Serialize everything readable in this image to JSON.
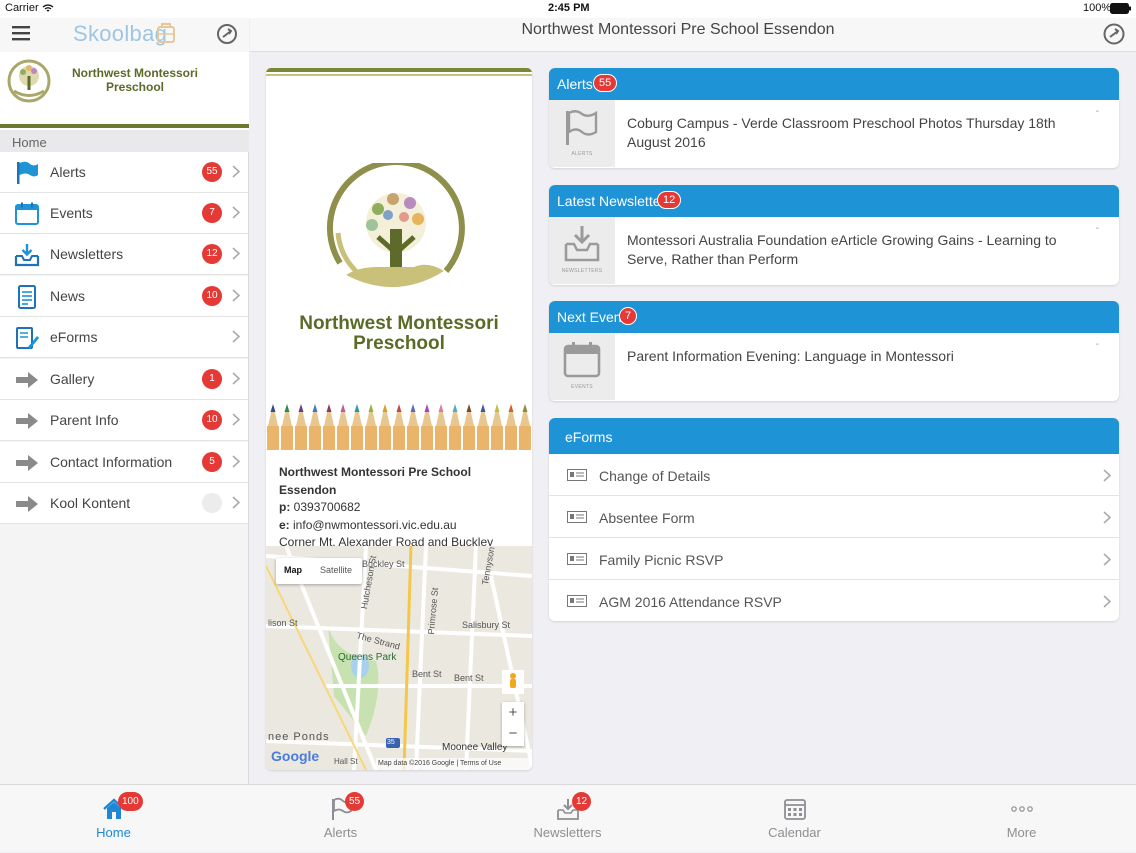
{
  "status": {
    "carrier": "Carrier",
    "time": "2:45 PM",
    "battery": "100%"
  },
  "sidebar": {
    "brand": "Skoolbag",
    "school_name_line1": "Northwest Montessori",
    "school_name_line2": "Preschool",
    "home_label": "Home",
    "items": [
      {
        "label": "Alerts",
        "badge": "55",
        "icon": "flag-icon"
      },
      {
        "label": "Events",
        "badge": "7",
        "icon": "calendar-icon"
      },
      {
        "label": "Newsletters",
        "badge": "12",
        "icon": "inbox-download-icon"
      },
      {
        "label": "News",
        "badge": "10",
        "icon": "document-icon"
      },
      {
        "label": "eForms",
        "badge": "",
        "icon": "form-pen-icon"
      },
      {
        "label": "Gallery",
        "badge": "1",
        "icon": "arrow-right-icon"
      },
      {
        "label": "Parent Info",
        "badge": "10",
        "icon": "arrow-right-icon"
      },
      {
        "label": "Contact Information",
        "badge": "5",
        "icon": "arrow-right-icon"
      },
      {
        "label": "Kool Kontent",
        "badge": "",
        "icon": "arrow-right-icon"
      }
    ]
  },
  "header": {
    "title": "Northwest Montessori Pre School Essendon"
  },
  "school_card": {
    "logo_line1": "Northwest Montessori",
    "logo_line2": "Preschool",
    "name": "Northwest Montessori Pre School Essendon",
    "phone_label": "p:",
    "phone": "0393700682",
    "email_label": "e:",
    "email": "info@nwmontessori.vic.edu.au",
    "address": "Corner Mt. Alexander Road and Buckley",
    "map": {
      "btn_map": "Map",
      "btn_satellite": "Satellite",
      "zoom_in": "+",
      "zoom_out": "−",
      "google": "Google",
      "attribution": "Map data ©2016 Google",
      "terms": "Terms of Use",
      "streets": [
        "Buckley St",
        "Hutcheson St",
        "Primrose St",
        "Tennyson",
        "Salisbury St",
        "The Strand",
        "Queens Park",
        "Bent St",
        "Bent St",
        "lison St",
        "nee Ponds",
        "Moonee Valley",
        "Hall St",
        "35"
      ]
    }
  },
  "alerts_card": {
    "title": "Alerts",
    "badge": "55",
    "thumb_caption": "ALERTS",
    "text": "Coburg Campus - Verde Classroom Preschool Photos Thursday 18th August 2016",
    "dash": "-"
  },
  "newsletter_card": {
    "title": "Latest Newsletter",
    "badge": "12",
    "thumb_caption": "NEWSLETTERS",
    "text": "Montessori Australia Foundation eArticle Growing Gains - Learning to Serve, Rather than Perform",
    "dash": "-"
  },
  "event_card": {
    "title": "Next Event",
    "badge": "7",
    "thumb_caption": "EVENTS",
    "text": "Parent Information Evening: Language in Montessori",
    "dash": "-"
  },
  "eforms_card": {
    "title": "eForms",
    "items": [
      "Change of Details",
      "Absentee Form",
      "Family Picnic RSVP",
      "AGM 2016 Attendance RSVP"
    ]
  },
  "tabbar": [
    {
      "label": "Home",
      "badge": "100",
      "icon": "home-icon",
      "active": true
    },
    {
      "label": "Alerts",
      "badge": "55",
      "icon": "flag-icon"
    },
    {
      "label": "Newsletters",
      "badge": "12",
      "icon": "inbox-download-icon"
    },
    {
      "label": "Calendar",
      "badge": "",
      "icon": "calendar-grid-icon"
    },
    {
      "label": "More",
      "badge": "",
      "icon": "more-dots-icon"
    }
  ],
  "colors": {
    "accent": "#1e93d6",
    "badge": "#e53935",
    "olive": "#6b7a2e",
    "tab_active": "#1e88d6"
  }
}
